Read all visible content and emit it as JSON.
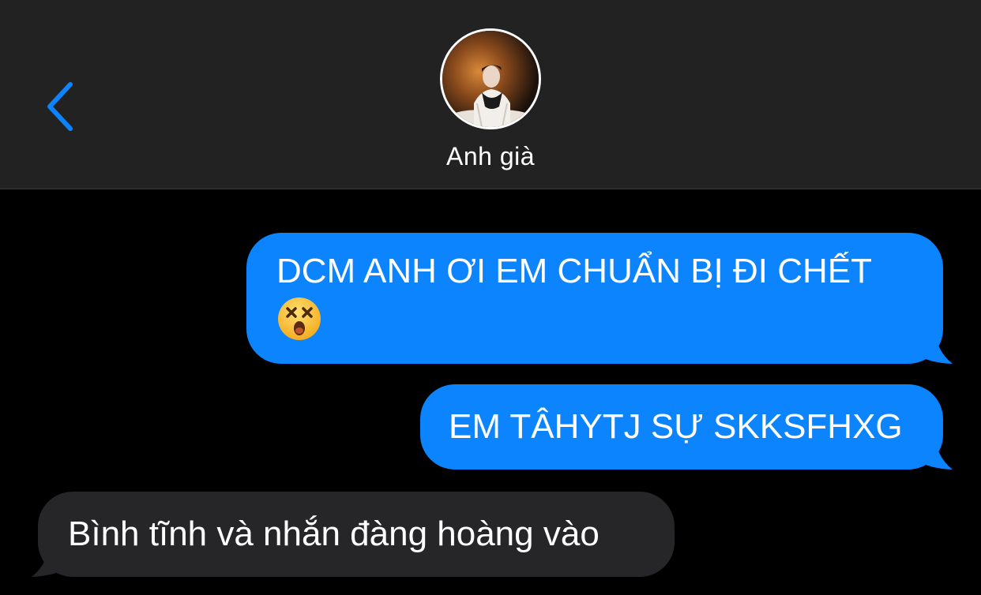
{
  "header": {
    "contact_name": "Anh già",
    "back_icon": "chevron-left-icon",
    "avatar_icon": "contact-avatar"
  },
  "colors": {
    "accent": "#0b84fe",
    "sent_bubble": "#0b84fe",
    "received_bubble": "#262628",
    "header_bg": "#222222",
    "background": "#000000"
  },
  "messages": [
    {
      "direction": "sent",
      "text": "DCM ANH ƠI EM CHUẨN BỊ ĐI CHẾT",
      "emoji": "dizzy-face-emoji"
    },
    {
      "direction": "sent",
      "text": "EM TÂHYTJ SỰ SKKSFHXG"
    },
    {
      "direction": "received",
      "text": "Bình tĩnh và nhắn đàng hoàng vào"
    }
  ]
}
